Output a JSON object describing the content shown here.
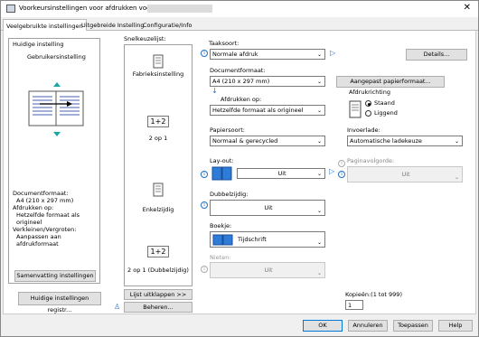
{
  "window": {
    "title": "Voorkeursinstellingen voor afdrukken voor",
    "close_glyph": "✕"
  },
  "tabs": [
    {
      "label": "Veelgebruikte instellingen"
    },
    {
      "label": "Uitgebreide Instelling"
    },
    {
      "label": "Configuratie/Info"
    }
  ],
  "left": {
    "current_setting_label": "Huidige instelling",
    "current_setting_value": "Gebruikersinstelling",
    "summary_lines": [
      "Documentformaat:",
      "A4 (210 x 297 mm)",
      "Afdrukken op:",
      "Hetzelfde formaat als origineel",
      "Verkleinen/Vergroten:",
      "Aanpassen aan afdrukformaat"
    ],
    "summary_button": "Samenvatting instellingen",
    "register_button": "Huidige instellingen registr..."
  },
  "quick": {
    "label": "Snelkeuzelijst:",
    "items": [
      {
        "label": "Fabrieksinstelling",
        "icon": "factory-doc-icon"
      },
      {
        "label": "2 op 1",
        "icon_text": "1+2"
      },
      {
        "label": "Enkelzijdig",
        "icon": "single-sided-icon"
      },
      {
        "label": "2 op 1 (Dubbelzijdig)",
        "icon_text": "1+2"
      }
    ],
    "expand_button": "Lijst uitklappen >>",
    "manage_button": "Beheren..."
  },
  "right": {
    "job_type": {
      "label": "Taaksoort:",
      "value": "Normale afdruk"
    },
    "details_button": "Details...",
    "doc_size": {
      "label": "Documentformaat:",
      "value": "A4 (210 x 297 mm)"
    },
    "custom_paper_button": "Aangepast papierformaat...",
    "print_on": {
      "label": "Afdrukken op:",
      "value": "Hetzelfde formaat als origineel"
    },
    "orientation": {
      "label": "Afdrukrichting",
      "options": [
        "Staand",
        "Liggend"
      ],
      "selected": "Staand"
    },
    "paper_type": {
      "label": "Papiersoort:",
      "value": "Normaal & gerecycled"
    },
    "input_tray": {
      "label": "Invoerlade:",
      "value": "Automatische ladekeuze"
    },
    "layout": {
      "label": "Lay-out:",
      "value": "Uit"
    },
    "page_order": {
      "label": "Paginavolgorde:",
      "value": "Uit"
    },
    "duplex": {
      "label": "Dubbelzijdig:",
      "value": "Uit"
    },
    "booklet": {
      "label": "Boekje:",
      "value": "Tijdschrift"
    },
    "staple": {
      "label": "Nieten:",
      "value": "Uit"
    },
    "copies": {
      "label": "Kopieën:(1 tot 999)",
      "value": "1"
    }
  },
  "footer": {
    "ok": "OK",
    "cancel": "Annuleren",
    "apply": "Toepassen",
    "help": "Help"
  },
  "colors": {
    "accent": "#1f6fc5",
    "select_blue": "#0078d7"
  }
}
